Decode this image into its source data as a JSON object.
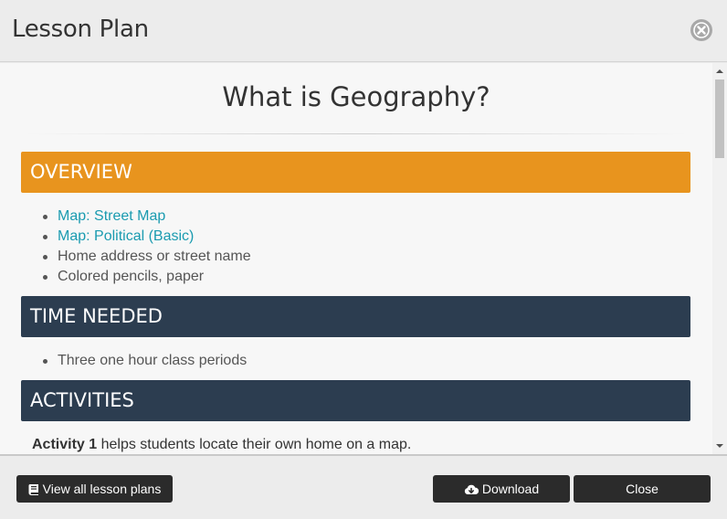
{
  "header": {
    "title": "Lesson Plan",
    "close_icon": "times-circle-icon"
  },
  "document": {
    "title": "What is Geography?",
    "sections": {
      "overview": {
        "heading": "OVERVIEW",
        "color": "#e8941e",
        "items": [
          {
            "text": "Map: Street Map",
            "link": true
          },
          {
            "text": "Map: Political (Basic)",
            "link": true
          },
          {
            "text": "Home address or street name",
            "link": false
          },
          {
            "text": "Colored pencils, paper",
            "link": false
          }
        ]
      },
      "time_needed": {
        "heading": "TIME NEEDED",
        "color": "#2c3d50",
        "items": [
          {
            "text": "Three one hour class periods",
            "link": false
          }
        ]
      },
      "activities": {
        "heading": "ACTIVITIES",
        "color": "#2c3d50",
        "activity1_label": "Activity 1",
        "activity1_text": " helps students locate their own home on a map."
      }
    }
  },
  "footer": {
    "view_all_label": "View all lesson plans",
    "view_all_icon": "book-icon",
    "download_label": "Download",
    "download_icon": "cloud-download-icon",
    "close_label": "Close"
  },
  "colors": {
    "link": "#1a9bb0",
    "button_bg": "#2b2b2b"
  }
}
